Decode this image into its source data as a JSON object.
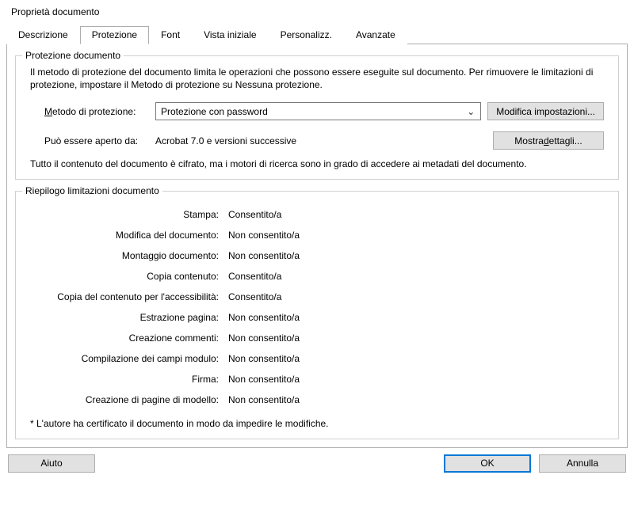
{
  "window": {
    "title": "Proprietà documento"
  },
  "tabs": {
    "items": [
      {
        "label": "Descrizione"
      },
      {
        "label": "Protezione"
      },
      {
        "label": "Font"
      },
      {
        "label": "Vista iniziale"
      },
      {
        "label": "Personalizz."
      },
      {
        "label": "Avanzate"
      }
    ],
    "active_index": 1
  },
  "protection_group": {
    "legend": "Protezione documento",
    "description": "Il metodo di protezione del documento limita le operazioni che possono essere eseguite sul documento. Per rimuovere le limitazioni di protezione, impostare il Metodo di protezione su Nessuna protezione.",
    "method_label_pre": "M",
    "method_label_rest": "etodo di protezione:",
    "method_value": "Protezione con password",
    "modify_button": "Modifica impostazioni...",
    "openable_label": "Può essere aperto da:",
    "openable_value": "Acrobat 7.0 e versioni successive",
    "details_button_pre": "Mostra ",
    "details_button_ul": "d",
    "details_button_rest": "ettagli...",
    "encrypt_note": "Tutto il contenuto del documento è cifrato, ma i motori di ricerca sono in grado di accedere ai metadati del documento."
  },
  "limits_group": {
    "legend": "Riepilogo limitazioni documento",
    "rows": [
      {
        "label": "Stampa:",
        "value": "Consentito/a"
      },
      {
        "label": "Modifica del documento:",
        "value": "Non consentito/a"
      },
      {
        "label": "Montaggio documento:",
        "value": "Non consentito/a"
      },
      {
        "label": "Copia contenuto:",
        "value": "Consentito/a"
      },
      {
        "label": "Copia del contenuto per l'accessibilità:",
        "value": "Consentito/a"
      },
      {
        "label": "Estrazione pagina:",
        "value": "Non consentito/a"
      },
      {
        "label": "Creazione commenti:",
        "value": "Non consentito/a"
      },
      {
        "label": "Compilazione dei campi modulo:",
        "value": "Non consentito/a"
      },
      {
        "label": "Firma:",
        "value": "Non consentito/a"
      },
      {
        "label": "Creazione di pagine di modello:",
        "value": "Non consentito/a"
      }
    ],
    "cert_note": "*    L'autore ha certificato il documento in modo da impedire le modifiche."
  },
  "footer": {
    "help": "Aiuto",
    "ok": "OK",
    "cancel": "Annulla"
  }
}
